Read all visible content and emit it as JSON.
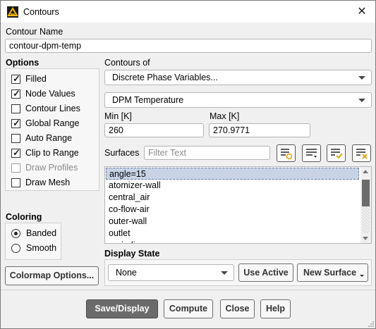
{
  "window": {
    "title": "Contours",
    "icon": "ansys-fluent-icon"
  },
  "contour_name": {
    "label": "Contour Name",
    "value": "contour-dpm-temp"
  },
  "options": {
    "label": "Options",
    "items": [
      {
        "label": "Filled",
        "checked": true,
        "disabled": false
      },
      {
        "label": "Node Values",
        "checked": true,
        "disabled": false
      },
      {
        "label": "Contour Lines",
        "checked": false,
        "disabled": false
      },
      {
        "label": "Global Range",
        "checked": true,
        "disabled": false
      },
      {
        "label": "Auto Range",
        "checked": false,
        "disabled": false
      },
      {
        "label": "Clip to Range",
        "checked": true,
        "disabled": false
      },
      {
        "label": "Draw Profiles",
        "checked": false,
        "disabled": true
      },
      {
        "label": "Draw Mesh",
        "checked": false,
        "disabled": false
      }
    ]
  },
  "coloring": {
    "label": "Coloring",
    "options": [
      {
        "label": "Banded",
        "selected": true
      },
      {
        "label": "Smooth",
        "selected": false
      }
    ]
  },
  "colormap_button": "Colormap Options...",
  "contours_of": {
    "label": "Contours of",
    "category": "Discrete Phase Variables...",
    "variable": "DPM Temperature"
  },
  "range": {
    "min_label": "Min [K]",
    "min_value": "260",
    "max_label": "Max [K]",
    "max_value": "270.9771"
  },
  "surfaces": {
    "label": "Surfaces",
    "filter_placeholder": "Filter Text",
    "icons": [
      "select-surfaces-icon",
      "filter-list-icon",
      "select-all-icon",
      "deselect-all-icon"
    ],
    "items": [
      "angle=15",
      "atomizer-wall",
      "central_air",
      "co-flow-air",
      "outer-wall",
      "outlet",
      "periodic"
    ],
    "selected": "angle=15"
  },
  "display_state": {
    "label": "Display State",
    "value": "None",
    "use_active": "Use Active",
    "new_surface": "New Surface"
  },
  "footer": {
    "save_display": "Save/Display",
    "compute": "Compute",
    "close": "Close",
    "help": "Help"
  },
  "colors": {
    "primary_button": "#6b6b6b",
    "selection": "#c8d4e6",
    "background": "#f0f0f0"
  }
}
